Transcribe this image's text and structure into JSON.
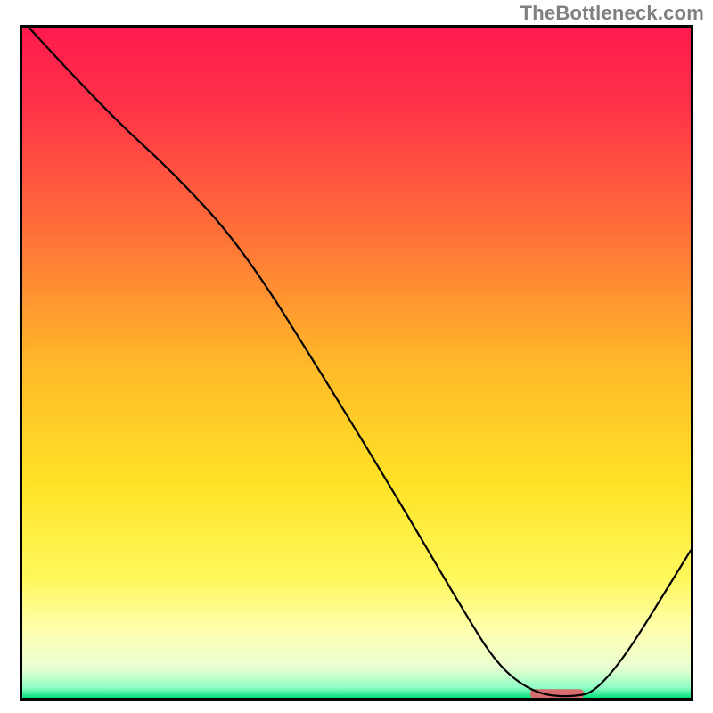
{
  "watermark": {
    "text": "TheBottleneck.com"
  },
  "chart_data": {
    "type": "line",
    "title": "",
    "xlabel": "",
    "ylabel": "",
    "xlim": [
      0,
      100
    ],
    "ylim": [
      0,
      100
    ],
    "grid": false,
    "legend": false,
    "series": [
      {
        "name": "curve",
        "x": [
          1,
          12,
          23,
          33,
          45,
          56,
          66,
          71,
          76,
          81,
          87,
          100
        ],
        "values": [
          100,
          88,
          78,
          67,
          48,
          30,
          13,
          5,
          1,
          0,
          1,
          22
        ]
      }
    ],
    "marker": {
      "name": "highlight-bar",
      "x_start": 76,
      "x_end": 84,
      "y": 0.6,
      "color": "#d76d6c"
    },
    "background_gradient": {
      "stops": [
        {
          "offset": 0.0,
          "color": "#ff1a4d"
        },
        {
          "offset": 0.12,
          "color": "#ff3348"
        },
        {
          "offset": 0.3,
          "color": "#ff6e39"
        },
        {
          "offset": 0.5,
          "color": "#ffb829"
        },
        {
          "offset": 0.68,
          "color": "#ffe327"
        },
        {
          "offset": 0.82,
          "color": "#fff85b"
        },
        {
          "offset": 0.9,
          "color": "#ffffb0"
        },
        {
          "offset": 0.955,
          "color": "#e9ffd2"
        },
        {
          "offset": 0.985,
          "color": "#8fffc5"
        },
        {
          "offset": 1.0,
          "color": "#00e07a"
        }
      ]
    }
  }
}
